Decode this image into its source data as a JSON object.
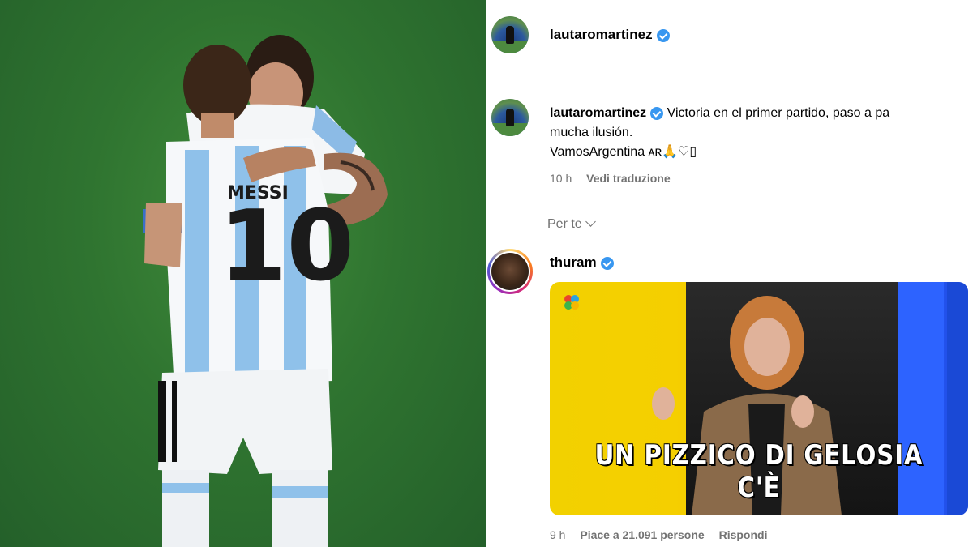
{
  "post": {
    "author": "lautaromartinez",
    "caption_username": "lautaromartinez",
    "caption_line1": "Victoria en el primer partido, paso a pa",
    "caption_line2": "mucha ilusión.",
    "caption_line3": "VamosArgentina ᴀʀ🙏♡▯",
    "time": "10 h",
    "translate": "Vedi traduzione"
  },
  "comments_section": {
    "label": "Per te"
  },
  "comment": {
    "username": "thuram",
    "gif_text": "UN PIZZICO DI GELOSIA C'È",
    "time": "9 h",
    "likes": "Piace a 21.091 persone",
    "reply": "Rispondi"
  },
  "photo": {
    "jersey_number": "10",
    "jersey_name": "MESSI"
  },
  "colors": {
    "verified": "#3897f0",
    "meta_text": "#737373",
    "pitch": "#2f7430",
    "gif_yellow": "#f2d100"
  }
}
